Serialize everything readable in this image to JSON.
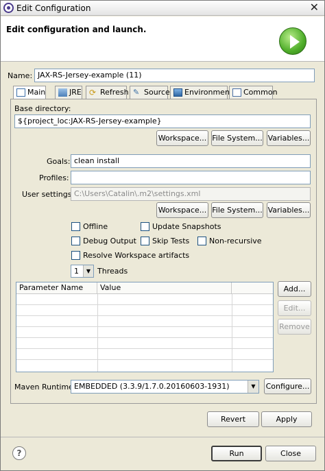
{
  "window": {
    "title": "Edit Configuration"
  },
  "header": {
    "heading": "Edit configuration and launch."
  },
  "name": {
    "label": "Name:",
    "value": "JAX-RS-Jersey-example (11)"
  },
  "tabs": [
    {
      "label": "Main",
      "icon": "main-tab-icon"
    },
    {
      "label": "JRE",
      "icon": "jre-icon"
    },
    {
      "label": "Refresh",
      "icon": "refresh-icon"
    },
    {
      "label": "Source",
      "icon": "source-icon"
    },
    {
      "label": "Environment",
      "icon": "environment-icon"
    },
    {
      "label": "Common",
      "icon": "common-icon"
    }
  ],
  "base_dir": {
    "label": "Base directory:",
    "value": "${project_loc:JAX-RS-Jersey-example}",
    "buttons": [
      "Workspace...",
      "File System...",
      "Variables..."
    ]
  },
  "goals": {
    "label": "Goals:",
    "value": "clean install"
  },
  "profiles": {
    "label": "Profiles:",
    "value": ""
  },
  "user_settings": {
    "label": "User settings:",
    "value": "C:\\Users\\Catalin\\.m2\\settings.xml",
    "buttons": [
      "Workspace...",
      "File System...",
      "Variables..."
    ]
  },
  "options": {
    "offline": "Offline",
    "update_snapshots": "Update Snapshots",
    "debug_output": "Debug Output",
    "skip_tests": "Skip Tests",
    "non_recursive": "Non-recursive",
    "resolve_workspace": "Resolve Workspace artifacts"
  },
  "threads": {
    "value": "1",
    "label": "Threads"
  },
  "params_table": {
    "columns": [
      "Parameter Name",
      "Value",
      ""
    ],
    "buttons": {
      "add": "Add...",
      "edit": "Edit...",
      "remove": "Remove"
    }
  },
  "runtime": {
    "label": "Maven Runtime:",
    "value": "EMBEDDED (3.3.9/1.7.0.20160603-1931)",
    "configure": "Configure..."
  },
  "footer": {
    "revert": "Revert",
    "apply": "Apply",
    "run": "Run",
    "close": "Close",
    "help": "?"
  }
}
